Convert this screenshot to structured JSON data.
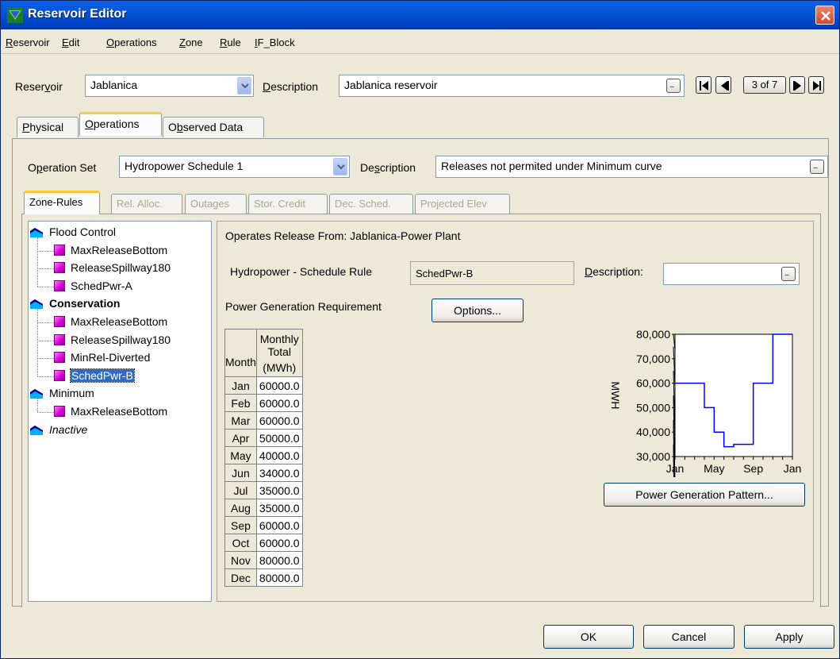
{
  "window": {
    "title": "Reservoir Editor"
  },
  "menu": [
    {
      "pre": "",
      "u": "R",
      "post": "eservoir"
    },
    {
      "pre": "",
      "u": "E",
      "post": "dit"
    },
    {
      "pre": "",
      "u": "O",
      "post": "perations"
    },
    {
      "pre": "",
      "u": "Z",
      "post": "one"
    },
    {
      "pre": "",
      "u": "R",
      "post": "ule"
    },
    {
      "pre": "",
      "u": "I",
      "post": "F_Block"
    }
  ],
  "reservoir": {
    "label_pre": "Reser",
    "label_u": "v",
    "label_post": "oir",
    "value": "Jablanica",
    "desc_label_u": "D",
    "desc_label_post": "escription",
    "desc_value": "Jablanica reservoir",
    "nav_counter": "3 of 7"
  },
  "tabs": [
    {
      "pre": "",
      "u": "P",
      "post": "hysical",
      "active": false
    },
    {
      "pre": "",
      "u": "O",
      "post": "perations",
      "active": true
    },
    {
      "pre": "O",
      "u": "b",
      "post": "served Data",
      "active": false
    }
  ],
  "operation_set": {
    "label_pre": "O",
    "label_u": "p",
    "label_post": "eration Set",
    "value": "Hydropower Schedule 1",
    "desc_label_pre": "De",
    "desc_label_u": "s",
    "desc_label_post": "cription",
    "desc_value": "Releases not permited under Minimum curve"
  },
  "subtabs": [
    {
      "label": "Zone-Rules",
      "active": true,
      "disabled": false
    },
    {
      "label": "Rel. Alloc.",
      "active": false,
      "disabled": true
    },
    {
      "label": "Outages",
      "active": false,
      "disabled": true
    },
    {
      "label": "Stor. Credit",
      "active": false,
      "disabled": true
    },
    {
      "label": "Dec. Sched.",
      "active": false,
      "disabled": true
    },
    {
      "label": "Projected Elev",
      "active": false,
      "disabled": true
    }
  ],
  "tree": {
    "groups": [
      {
        "label": "Flood Control",
        "bold": false,
        "italic": false,
        "rules": [
          "MaxReleaseBottom",
          "ReleaseSpillway180",
          "SchedPwr-A"
        ]
      },
      {
        "label": "Conservation",
        "bold": true,
        "italic": false,
        "rules": [
          "MaxReleaseBottom",
          "ReleaseSpillway180",
          "MinRel-Diverted",
          "SchedPwr-B"
        ]
      },
      {
        "label": "Minimum",
        "bold": false,
        "italic": false,
        "rules": [
          "MaxReleaseBottom"
        ]
      },
      {
        "label": "Inactive",
        "bold": false,
        "italic": true,
        "rules": []
      }
    ],
    "selected": "SchedPwr-B"
  },
  "rule_panel": {
    "operates_from": "Operates Release From: Jablanica-Power Plant",
    "rule_label": "Hydropower - Schedule Rule",
    "rule_value": "SchedPwr-B",
    "desc_label_u": "D",
    "desc_label_post": "escription:",
    "desc_value": "",
    "power_req_label": "Power Generation Requirement",
    "options_button": "Options...",
    "pattern_button": "Power Generation Pattern..."
  },
  "table": {
    "col_month": "Month",
    "col_total_line1": "Monthly Total",
    "col_total_line2": "(MWh)",
    "rows": [
      {
        "month": "Jan",
        "value": "60000.0"
      },
      {
        "month": "Feb",
        "value": "60000.0"
      },
      {
        "month": "Mar",
        "value": "60000.0"
      },
      {
        "month": "Apr",
        "value": "50000.0"
      },
      {
        "month": "May",
        "value": "40000.0"
      },
      {
        "month": "Jun",
        "value": "34000.0"
      },
      {
        "month": "Jul",
        "value": "35000.0"
      },
      {
        "month": "Aug",
        "value": "35000.0"
      },
      {
        "month": "Sep",
        "value": "60000.0"
      },
      {
        "month": "Oct",
        "value": "60000.0"
      },
      {
        "month": "Nov",
        "value": "80000.0"
      },
      {
        "month": "Dec",
        "value": "80000.0"
      }
    ]
  },
  "chart_data": {
    "type": "line",
    "step": true,
    "ylabel": "MWH",
    "ylim": [
      30000,
      80000
    ],
    "yticks": [
      "30,000",
      "40,000",
      "50,000",
      "60,000",
      "70,000",
      "80,000"
    ],
    "xtick_labels": [
      "Jan",
      "May",
      "Sep",
      "Jan"
    ],
    "series": [
      {
        "x": [
          "Jan",
          "Feb",
          "Mar",
          "Apr",
          "May",
          "Jun",
          "Jul",
          "Aug",
          "Sep",
          "Oct",
          "Nov",
          "Dec"
        ],
        "values": [
          60000,
          60000,
          60000,
          50000,
          40000,
          34000,
          35000,
          35000,
          60000,
          60000,
          80000,
          80000
        ],
        "color": "#0000ff"
      }
    ]
  },
  "buttons": {
    "ok": "OK",
    "cancel": "Cancel",
    "apply": "Apply"
  }
}
